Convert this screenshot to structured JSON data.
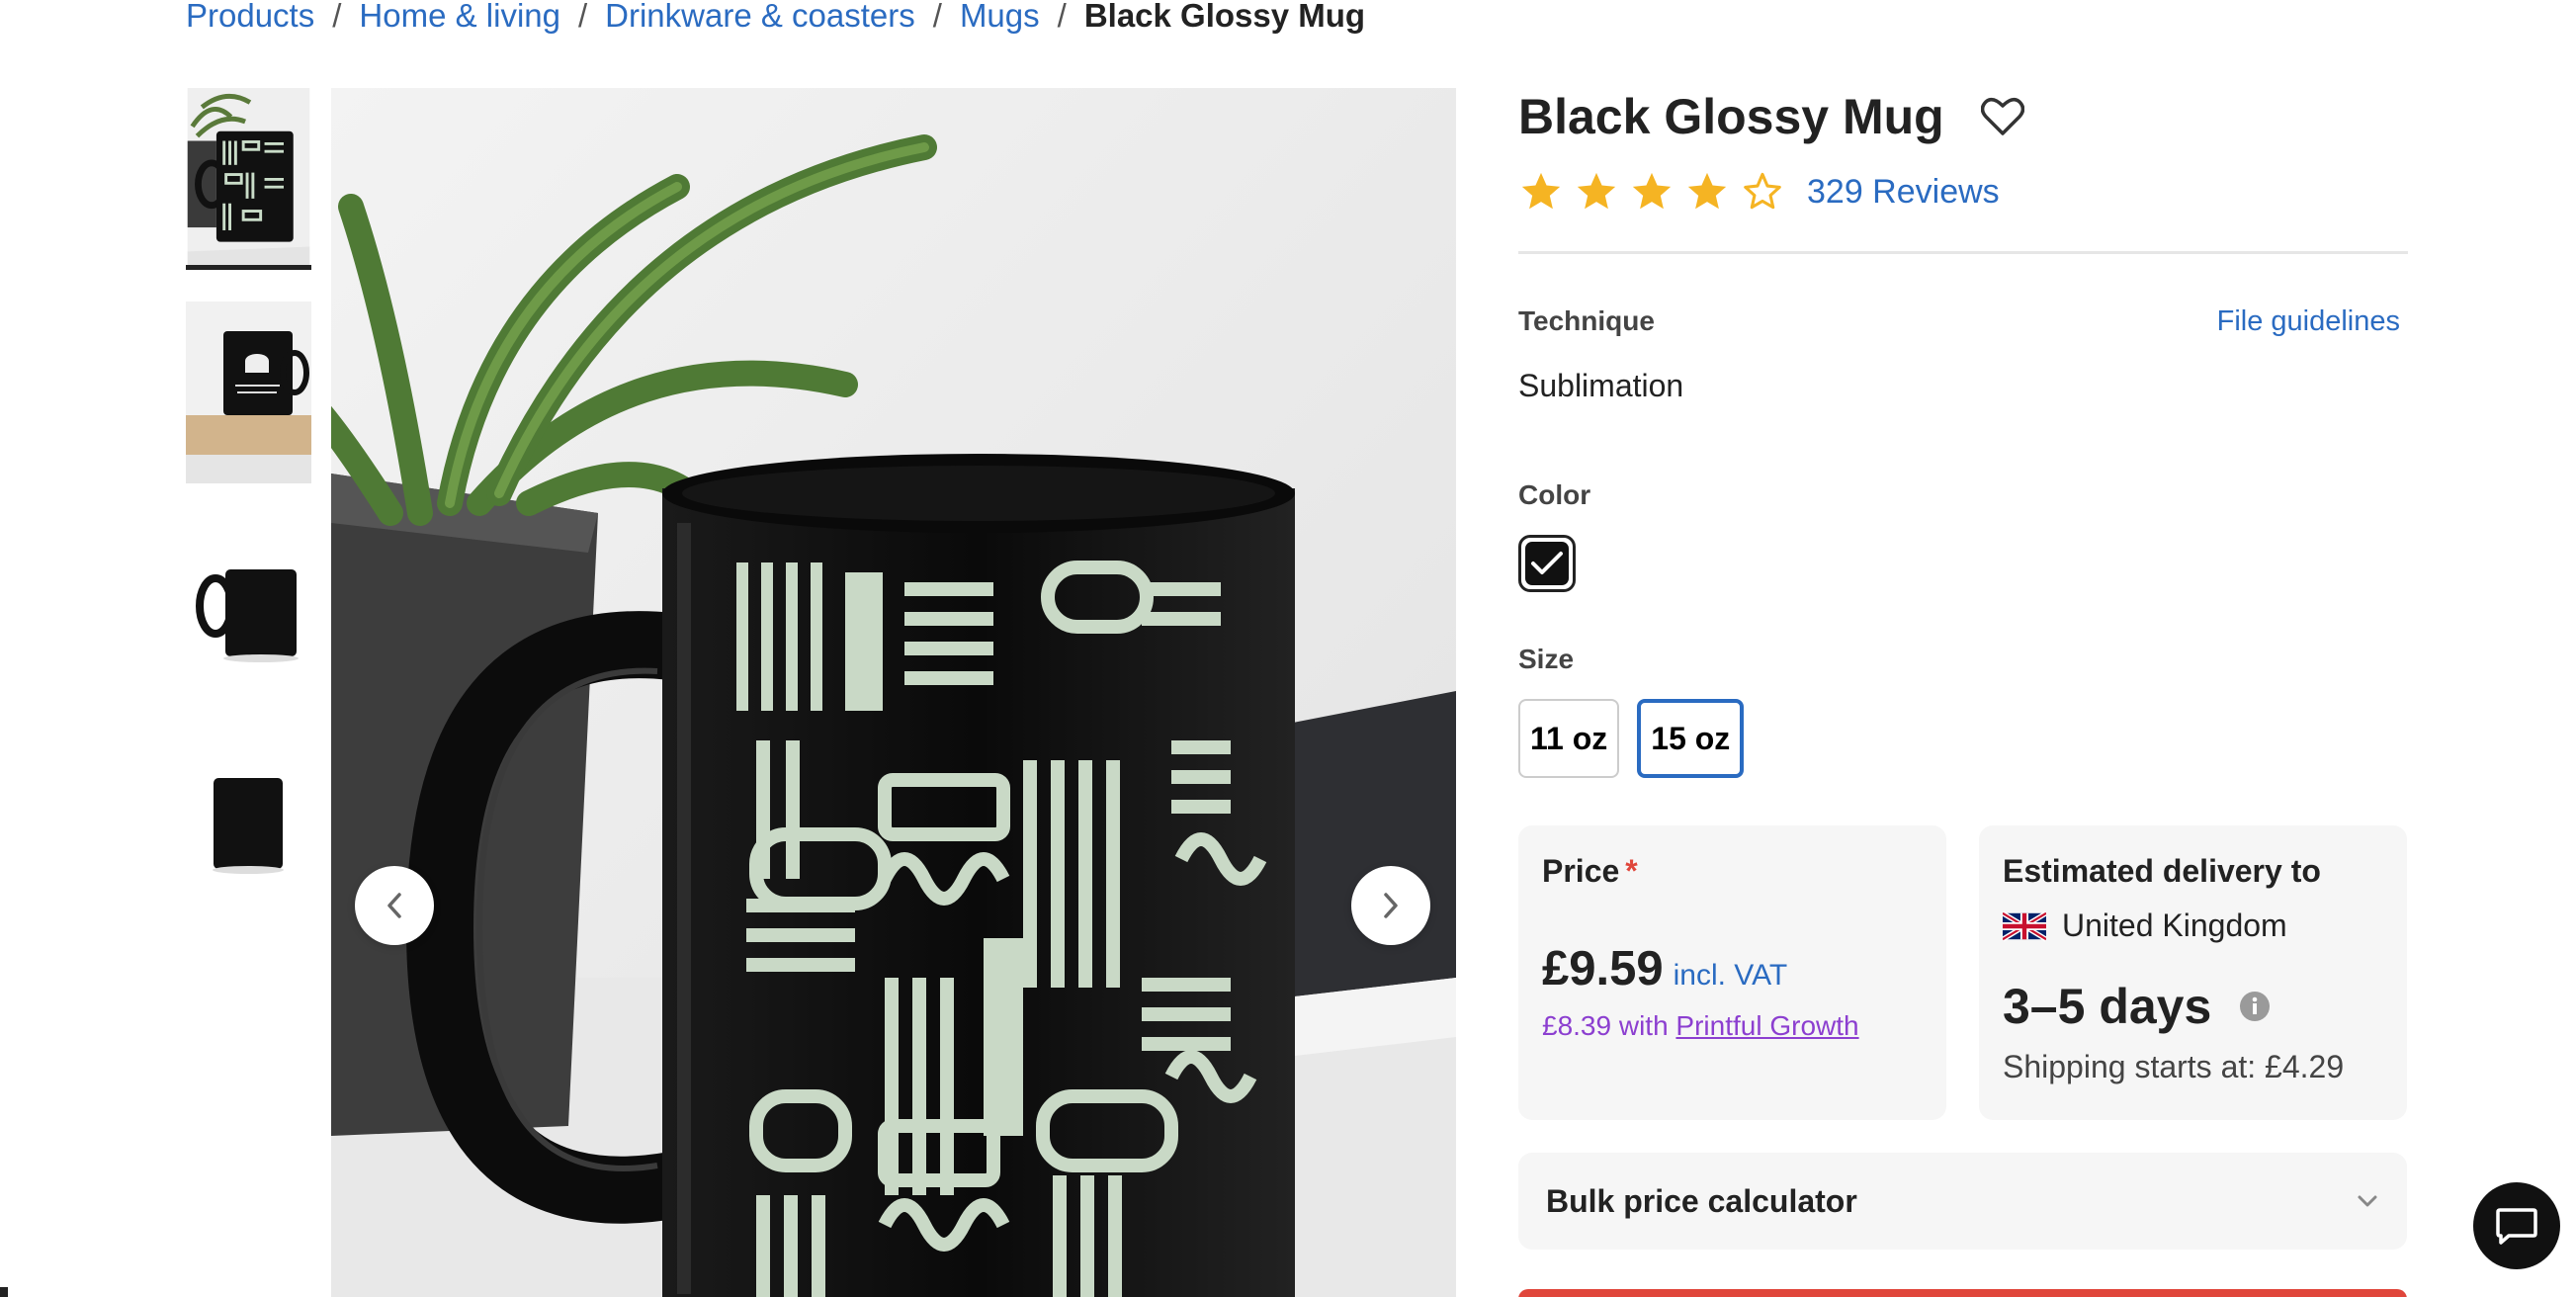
{
  "breadcrumb": {
    "items": [
      "Products",
      "Home & living",
      "Drinkware & coasters",
      "Mugs"
    ],
    "separator": "/",
    "current": "Black Glossy Mug"
  },
  "gallery": {
    "thumbnails": [
      "mug-with-plant-thumbnail",
      "mug-on-wood-block-thumbnail",
      "mug-side-view-thumbnail",
      "mug-front-view-thumbnail"
    ],
    "active_index": 0,
    "prev_icon": "chevron-left-icon",
    "next_icon": "chevron-right-icon"
  },
  "product": {
    "title": "Black Glossy Mug",
    "favorite_icon": "heart-outline-icon",
    "rating": 4,
    "rating_max": 5,
    "reviews_label": "329 Reviews",
    "star_color": "#f5b423"
  },
  "options": {
    "technique_label": "Technique",
    "file_guidelines_link": "File guidelines",
    "technique_value": "Sublimation",
    "color_label": "Color",
    "colors": [
      {
        "name": "Black",
        "hex": "#111111",
        "selected": true
      }
    ],
    "size_label": "Size",
    "sizes": [
      "11 oz",
      "15 oz"
    ],
    "selected_size": "15 oz"
  },
  "price_card": {
    "title": "Price",
    "required_mark": "*",
    "price": "£9.59",
    "vat_label": "incl. VAT",
    "growth_prefix": "£8.39 with",
    "growth_link": "Printful Growth"
  },
  "delivery_card": {
    "title": "Estimated delivery to",
    "country": "United Kingdom",
    "flag_icon": "uk-flag-icon",
    "days": "3–5 days",
    "info_icon": "info-icon",
    "shipping": "Shipping starts at: £4.29"
  },
  "bulk": {
    "label": "Bulk price calculator",
    "icon": "chevron-down-icon"
  },
  "chat": {
    "icon": "chat-bubble-icon"
  },
  "colors": {
    "link": "#2a6bc1",
    "accent_red": "#e0463b",
    "growth_purple": "#8c3fd0",
    "selected_border": "#2a6bc1"
  }
}
